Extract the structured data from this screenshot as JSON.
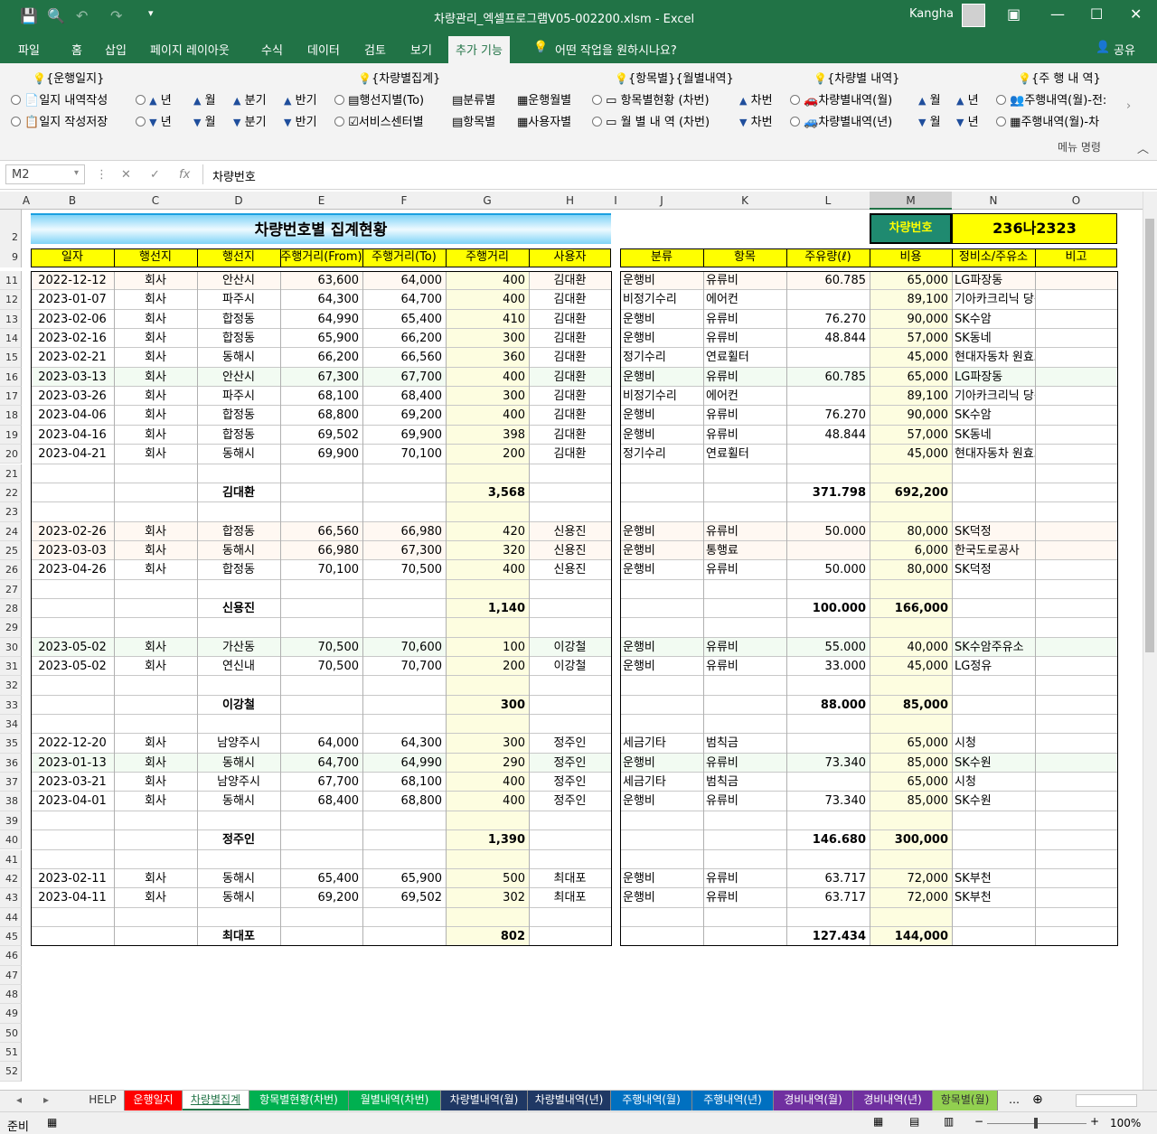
{
  "window": {
    "title": "차량관리_엑셀프로그램V05-002200.xlsm  -  Excel",
    "user": "Kangha"
  },
  "menu": [
    "파일",
    "홈",
    "삽입",
    "페이지 레이아웃",
    "수식",
    "데이터",
    "검토",
    "보기",
    "추가 기능"
  ],
  "menu_search": "어떤 작업을 원하시나요?",
  "share": "공유",
  "ribbon": {
    "group_labels": [
      "{운행일지}",
      "{차량별집계}",
      "{항목별}{월별내역}",
      "{차량별 내역}",
      "{주 행 내 역}"
    ],
    "row1": [
      "일지 내역작성",
      "년",
      "월",
      "분기",
      "반기",
      "행선지별(To)",
      "분류별",
      "운행월별",
      "항목별현황 (차번)",
      "차번",
      "차량별내역(월)",
      "월",
      "년",
      "주행내역(월)-전:"
    ],
    "row2": [
      "일지 작성저장",
      "년",
      "월",
      "분기",
      "반기",
      "서비스센터별",
      "항목별",
      "사용자별",
      "월 별 내 역 (차번)",
      "차번",
      "차량별내역(년)",
      "월",
      "년",
      "주행내역(월)-차"
    ],
    "footer": "메뉴 명령"
  },
  "formula_bar": {
    "name_box": "M2",
    "content": "차량번호"
  },
  "columns": [
    "A",
    "B",
    "C",
    "D",
    "E",
    "F",
    "G",
    "H",
    "I",
    "J",
    "K",
    "L",
    "M",
    "N",
    "O"
  ],
  "sheet": {
    "title": "차량번호별 집계현황",
    "vehicle_label": "차량번호",
    "vehicle_value": "236나2323",
    "left_headers": [
      "일자",
      "행선지",
      "행선지",
      "주행거리(From)",
      "주행거리(To)",
      "주행거리",
      "사용자"
    ],
    "right_headers": [
      "분류",
      "항목",
      "주유량(ℓ)",
      "비용",
      "정비소/주유소",
      "비고"
    ],
    "rows": [
      {
        "n": "11",
        "d": "2022-12-12",
        "c": "회사",
        "p": "안산시",
        "f": "63,600",
        "t": "64,000",
        "km": "400",
        "u": "김대환",
        "cat": "운행비",
        "item": "유류비",
        "fuel": "60.785",
        "cost": "65,000",
        "shop": "LG파장동"
      },
      {
        "n": "12",
        "d": "2023-01-07",
        "c": "회사",
        "p": "파주시",
        "f": "64,300",
        "t": "64,700",
        "km": "400",
        "u": "김대환",
        "cat": "비정기수리",
        "item": "에어컨",
        "fuel": "",
        "cost": "89,100",
        "shop": "기아카크리닉 당산점"
      },
      {
        "n": "13",
        "d": "2023-02-06",
        "c": "회사",
        "p": "합정동",
        "f": "64,990",
        "t": "65,400",
        "km": "410",
        "u": "김대환",
        "cat": "운행비",
        "item": "유류비",
        "fuel": "76.270",
        "cost": "90,000",
        "shop": "SK수암"
      },
      {
        "n": "14",
        "d": "2023-02-16",
        "c": "회사",
        "p": "합정동",
        "f": "65,900",
        "t": "66,200",
        "km": "300",
        "u": "김대환",
        "cat": "운행비",
        "item": "유류비",
        "fuel": "48.844",
        "cost": "57,000",
        "shop": "SK동네"
      },
      {
        "n": "15",
        "d": "2023-02-21",
        "c": "회사",
        "p": "동해시",
        "f": "66,200",
        "t": "66,560",
        "km": "360",
        "u": "김대환",
        "cat": "정기수리",
        "item": "연료휠터",
        "fuel": "",
        "cost": "45,000",
        "shop": "현대자동차 원효로"
      },
      {
        "n": "16",
        "d": "2023-03-13",
        "c": "회사",
        "p": "안산시",
        "f": "67,300",
        "t": "67,700",
        "km": "400",
        "u": "김대환",
        "cat": "운행비",
        "item": "유류비",
        "fuel": "60.785",
        "cost": "65,000",
        "shop": "LG파장동"
      },
      {
        "n": "17",
        "d": "2023-03-26",
        "c": "회사",
        "p": "파주시",
        "f": "68,100",
        "t": "68,400",
        "km": "300",
        "u": "김대환",
        "cat": "비정기수리",
        "item": "에어컨",
        "fuel": "",
        "cost": "89,100",
        "shop": "기아카크리닉 당산점"
      },
      {
        "n": "18",
        "d": "2023-04-06",
        "c": "회사",
        "p": "합정동",
        "f": "68,800",
        "t": "69,200",
        "km": "400",
        "u": "김대환",
        "cat": "운행비",
        "item": "유류비",
        "fuel": "76.270",
        "cost": "90,000",
        "shop": "SK수암"
      },
      {
        "n": "19",
        "d": "2023-04-16",
        "c": "회사",
        "p": "합정동",
        "f": "69,502",
        "t": "69,900",
        "km": "398",
        "u": "김대환",
        "cat": "운행비",
        "item": "유류비",
        "fuel": "48.844",
        "cost": "57,000",
        "shop": "SK동네"
      },
      {
        "n": "20",
        "d": "2023-04-21",
        "c": "회사",
        "p": "동해시",
        "f": "69,900",
        "t": "70,100",
        "km": "200",
        "u": "김대환",
        "cat": "정기수리",
        "item": "연료휠터",
        "fuel": "",
        "cost": "45,000",
        "shop": "현대자동차 원효로"
      },
      {
        "n": "21"
      },
      {
        "n": "22",
        "sub": "김대환",
        "km": "3,568",
        "fuel": "371.798",
        "cost": "692,200"
      },
      {
        "n": "23"
      },
      {
        "n": "24",
        "d": "2023-02-26",
        "c": "회사",
        "p": "합정동",
        "f": "66,560",
        "t": "66,980",
        "km": "420",
        "u": "신용진",
        "cat": "운행비",
        "item": "유류비",
        "fuel": "50.000",
        "cost": "80,000",
        "shop": "SK덕정"
      },
      {
        "n": "25",
        "d": "2023-03-03",
        "c": "회사",
        "p": "동해시",
        "f": "66,980",
        "t": "67,300",
        "km": "320",
        "u": "신용진",
        "cat": "운행비",
        "item": "통행료",
        "fuel": "",
        "cost": "6,000",
        "shop": "한국도로공사"
      },
      {
        "n": "26",
        "d": "2023-04-26",
        "c": "회사",
        "p": "합정동",
        "f": "70,100",
        "t": "70,500",
        "km": "400",
        "u": "신용진",
        "cat": "운행비",
        "item": "유류비",
        "fuel": "50.000",
        "cost": "80,000",
        "shop": "SK덕정"
      },
      {
        "n": "27"
      },
      {
        "n": "28",
        "sub": "신용진",
        "km": "1,140",
        "fuel": "100.000",
        "cost": "166,000"
      },
      {
        "n": "29"
      },
      {
        "n": "30",
        "d": "2023-05-02",
        "c": "회사",
        "p": "가산동",
        "f": "70,500",
        "t": "70,600",
        "km": "100",
        "u": "이강철",
        "cat": "운행비",
        "item": "유류비",
        "fuel": "55.000",
        "cost": "40,000",
        "shop": "SK수암주유소"
      },
      {
        "n": "31",
        "d": "2023-05-02",
        "c": "회사",
        "p": "연신내",
        "f": "70,500",
        "t": "70,700",
        "km": "200",
        "u": "이강철",
        "cat": "운행비",
        "item": "유류비",
        "fuel": "33.000",
        "cost": "45,000",
        "shop": "LG정유"
      },
      {
        "n": "32"
      },
      {
        "n": "33",
        "sub": "이강철",
        "km": "300",
        "fuel": "88.000",
        "cost": "85,000"
      },
      {
        "n": "34"
      },
      {
        "n": "35",
        "d": "2022-12-20",
        "c": "회사",
        "p": "남양주시",
        "f": "64,000",
        "t": "64,300",
        "km": "300",
        "u": "정주인",
        "cat": "세금기타",
        "item": "범칙금",
        "fuel": "",
        "cost": "65,000",
        "shop": "시청"
      },
      {
        "n": "36",
        "d": "2023-01-13",
        "c": "회사",
        "p": "동해시",
        "f": "64,700",
        "t": "64,990",
        "km": "290",
        "u": "정주인",
        "cat": "운행비",
        "item": "유류비",
        "fuel": "73.340",
        "cost": "85,000",
        "shop": "SK수원"
      },
      {
        "n": "37",
        "d": "2023-03-21",
        "c": "회사",
        "p": "남양주시",
        "f": "67,700",
        "t": "68,100",
        "km": "400",
        "u": "정주인",
        "cat": "세금기타",
        "item": "범칙금",
        "fuel": "",
        "cost": "65,000",
        "shop": "시청"
      },
      {
        "n": "38",
        "d": "2023-04-01",
        "c": "회사",
        "p": "동해시",
        "f": "68,400",
        "t": "68,800",
        "km": "400",
        "u": "정주인",
        "cat": "운행비",
        "item": "유류비",
        "fuel": "73.340",
        "cost": "85,000",
        "shop": "SK수원"
      },
      {
        "n": "39"
      },
      {
        "n": "40",
        "sub": "정주인",
        "km": "1,390",
        "fuel": "146.680",
        "cost": "300,000"
      },
      {
        "n": "41"
      },
      {
        "n": "42",
        "d": "2023-02-11",
        "c": "회사",
        "p": "동해시",
        "f": "65,400",
        "t": "65,900",
        "km": "500",
        "u": "최대포",
        "cat": "운행비",
        "item": "유류비",
        "fuel": "63.717",
        "cost": "72,000",
        "shop": "SK부천"
      },
      {
        "n": "43",
        "d": "2023-04-11",
        "c": "회사",
        "p": "동해시",
        "f": "69,200",
        "t": "69,502",
        "km": "302",
        "u": "최대포",
        "cat": "운행비",
        "item": "유류비",
        "fuel": "63.717",
        "cost": "72,000",
        "shop": "SK부천"
      },
      {
        "n": "44"
      },
      {
        "n": "45",
        "sub": "최대포",
        "km": "802",
        "fuel": "127.434",
        "cost": "144,000"
      },
      {
        "n": "46"
      },
      {
        "n": "47"
      },
      {
        "n": "48"
      },
      {
        "n": "49"
      },
      {
        "n": "50"
      },
      {
        "n": "51"
      },
      {
        "n": "52"
      }
    ]
  },
  "tabs": [
    {
      "label": "HELP",
      "bg": "#f0f0f0",
      "fg": "#333"
    },
    {
      "label": "운행일지",
      "bg": "#ff0000",
      "fg": "#fff"
    },
    {
      "label": "차량별집계",
      "bg": "#ffffff",
      "fg": "#217346",
      "active": true
    },
    {
      "label": "항목별현황(차번)",
      "bg": "#00b050",
      "fg": "#fff"
    },
    {
      "label": "월별내역(차번)",
      "bg": "#00b050",
      "fg": "#fff"
    },
    {
      "label": "차량별내역(월)",
      "bg": "#1f3864",
      "fg": "#fff"
    },
    {
      "label": "차량별내역(년)",
      "bg": "#1f3864",
      "fg": "#fff"
    },
    {
      "label": "주행내역(월)",
      "bg": "#0070c0",
      "fg": "#fff"
    },
    {
      "label": "주행내역(년)",
      "bg": "#0070c0",
      "fg": "#fff"
    },
    {
      "label": "경비내역(월)",
      "bg": "#7030a0",
      "fg": "#fff"
    },
    {
      "label": "경비내역(년)",
      "bg": "#7030a0",
      "fg": "#fff"
    },
    {
      "label": "항목별(월)",
      "bg": "#92d050",
      "fg": "#333"
    }
  ],
  "status": {
    "ready": "준비",
    "zoom": "100%"
  }
}
